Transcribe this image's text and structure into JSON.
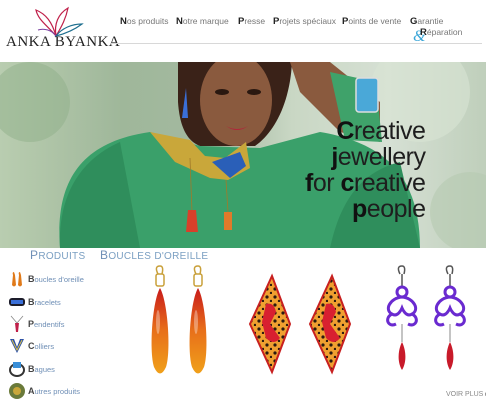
{
  "brand": {
    "name": "ANKA BYANKA"
  },
  "nav": {
    "items": [
      {
        "first": "N",
        "rest": "os produits"
      },
      {
        "first": "N",
        "rest": "otre marque"
      },
      {
        "first": "P",
        "rest": "resse"
      },
      {
        "first": "P",
        "rest": "rojets spéciaux"
      },
      {
        "first": "P",
        "rest": "oints de vente"
      },
      {
        "first": "G",
        "rest": "arantie"
      }
    ],
    "amp": "&",
    "extra": {
      "first": "R",
      "rest": "éparation"
    }
  },
  "hero": {
    "lines": [
      {
        "first": "C",
        "rest": "reative"
      },
      {
        "first": "j",
        "rest": "ewellery"
      },
      {
        "first": "f",
        "rest": "or ",
        "first2": "c",
        "rest2": "reative"
      },
      {
        "first": "p",
        "rest": "eople"
      }
    ]
  },
  "tabs": [
    {
      "first": "P",
      "rest": "RODUITS"
    },
    {
      "first": "B",
      "rest": "OUCLES D'OREILLE"
    }
  ],
  "categories": [
    {
      "first": "B",
      "rest": "oucles d'oreille",
      "icon": "earring-icon"
    },
    {
      "first": "B",
      "rest": "racelets",
      "icon": "bracelet-icon"
    },
    {
      "first": "P",
      "rest": "endentifs",
      "icon": "pendant-icon"
    },
    {
      "first": "C",
      "rest": "olliers",
      "icon": "necklace-icon"
    },
    {
      "first": "B",
      "rest": "agues",
      "icon": "ring-icon"
    },
    {
      "first": "A",
      "rest": "utres produits",
      "icon": "other-products-icon"
    }
  ],
  "voir_plus": "VOIR PLUS",
  "voir_arrow": "▸",
  "colors": {
    "accent": "#6f8fb6",
    "hero_bg": "#a4b9a1",
    "amp": "#3aa6d8"
  }
}
